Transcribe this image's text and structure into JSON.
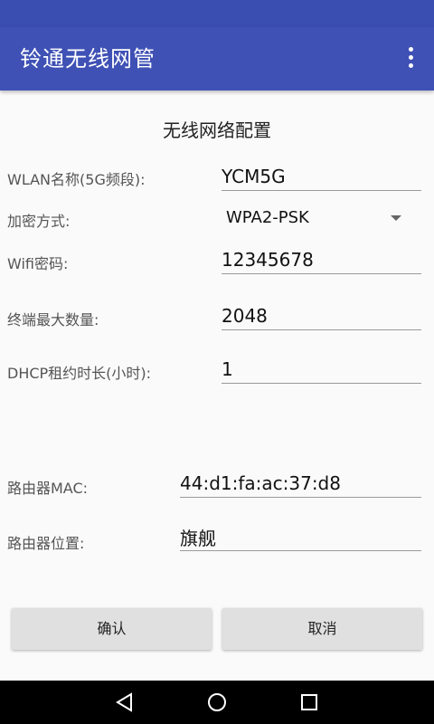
{
  "app": {
    "title": "铃通无线网管"
  },
  "form": {
    "title": "无线网络配置",
    "wlan_name": {
      "label": "WLAN名称(5G频段):",
      "value": "YCM5G"
    },
    "encryption": {
      "label": "加密方式:",
      "value": "WPA2-PSK"
    },
    "wifi_password": {
      "label": "Wifi密码:",
      "value": "12345678"
    },
    "max_terminals": {
      "label": "终端最大数量:",
      "value": "2048"
    },
    "dhcp_lease": {
      "label": "DHCP租约时长(小时):",
      "value": "1"
    },
    "router_mac": {
      "label": "路由器MAC:",
      "value": "44:d1:fa:ac:37:d8"
    },
    "router_location": {
      "label": "路由器位置:",
      "value": "旗舰"
    }
  },
  "buttons": {
    "confirm": "确认",
    "cancel": "取消"
  },
  "colors": {
    "app_bar": "#3f51b5",
    "status_bar": "#3a4db1",
    "background": "#fafafa",
    "button": "#e0e0e0"
  }
}
